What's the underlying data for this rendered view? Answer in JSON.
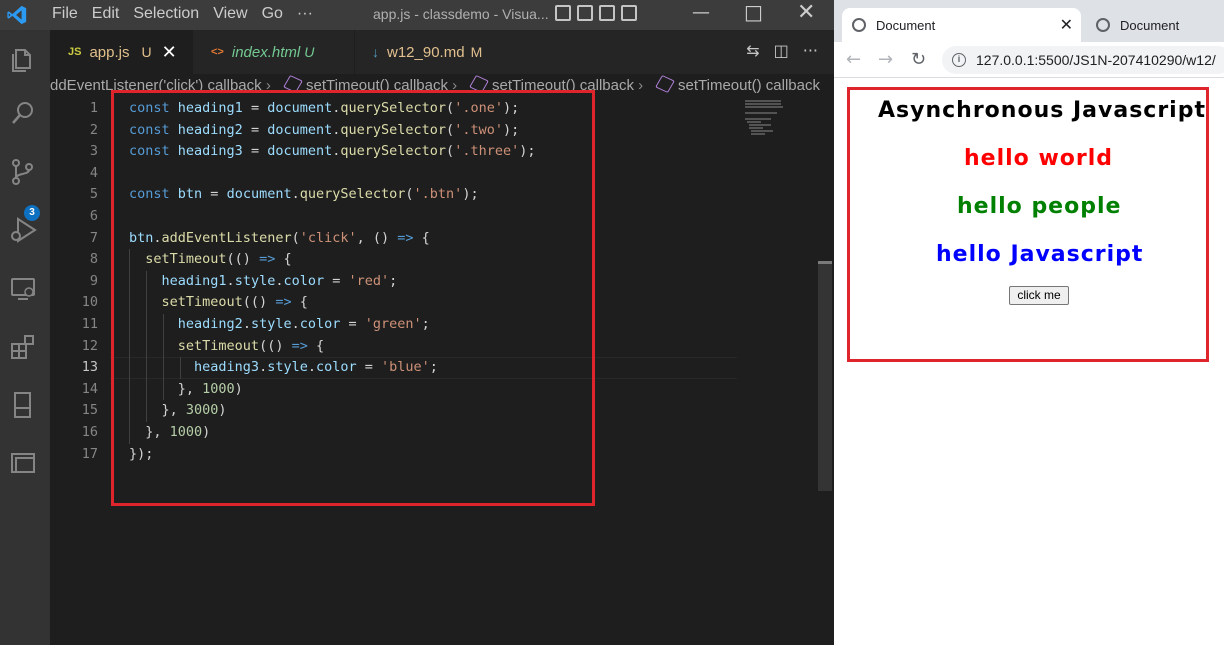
{
  "vscode": {
    "menu": [
      "File",
      "Edit",
      "Selection",
      "View",
      "Go",
      "···"
    ],
    "window_title": "app.js - classdemo - Visua...",
    "scm_badge": "3",
    "tabs": [
      {
        "icon": "JS",
        "label": "app.js",
        "status": "U",
        "active": true,
        "color": "#e2c08d"
      },
      {
        "icon": "<>",
        "label": "index.html",
        "status": "U",
        "active": false,
        "color": "#73c991"
      },
      {
        "icon": "↓",
        "label": "w12_90.md",
        "status": "M",
        "active": false,
        "color": "#e2c08d"
      }
    ],
    "breadcrumbs": [
      "ddEventListener('click') callback",
      "setTimeout() callback",
      "setTimeout() callback",
      "setTimeout() callback"
    ],
    "line_numbers": [
      "1",
      "2",
      "3",
      "4",
      "5",
      "6",
      "7",
      "8",
      "9",
      "10",
      "11",
      "12",
      "13",
      "14",
      "15",
      "16",
      "17"
    ],
    "current_line": "13",
    "code": [
      [
        [
          "kw",
          "const "
        ],
        [
          "vr",
          "heading1"
        ],
        [
          "pl",
          " = "
        ],
        [
          "vr",
          "document"
        ],
        [
          "pl",
          "."
        ],
        [
          "fn",
          "querySelector"
        ],
        [
          "pl",
          "("
        ],
        [
          "st",
          "'.one'"
        ],
        [
          "pl",
          ");"
        ]
      ],
      [
        [
          "kw",
          "const "
        ],
        [
          "vr",
          "heading2"
        ],
        [
          "pl",
          " = "
        ],
        [
          "vr",
          "document"
        ],
        [
          "pl",
          "."
        ],
        [
          "fn",
          "querySelector"
        ],
        [
          "pl",
          "("
        ],
        [
          "st",
          "'.two'"
        ],
        [
          "pl",
          ");"
        ]
      ],
      [
        [
          "kw",
          "const "
        ],
        [
          "vr",
          "heading3"
        ],
        [
          "pl",
          " = "
        ],
        [
          "vr",
          "document"
        ],
        [
          "pl",
          "."
        ],
        [
          "fn",
          "querySelector"
        ],
        [
          "pl",
          "("
        ],
        [
          "st",
          "'.three'"
        ],
        [
          "pl",
          ");"
        ]
      ],
      [],
      [
        [
          "kw",
          "const "
        ],
        [
          "vr",
          "btn"
        ],
        [
          "pl",
          " = "
        ],
        [
          "vr",
          "document"
        ],
        [
          "pl",
          "."
        ],
        [
          "fn",
          "querySelector"
        ],
        [
          "pl",
          "("
        ],
        [
          "st",
          "'.btn'"
        ],
        [
          "pl",
          ");"
        ]
      ],
      [],
      [
        [
          "vr",
          "btn"
        ],
        [
          "pl",
          "."
        ],
        [
          "fn",
          "addEventListener"
        ],
        [
          "pl",
          "("
        ],
        [
          "st",
          "'click'"
        ],
        [
          "pl",
          ", () "
        ],
        [
          "kw",
          "=>"
        ],
        [
          "pl",
          " {"
        ]
      ],
      [
        [
          "pl",
          "  "
        ],
        [
          "fn",
          "setTimeout"
        ],
        [
          "pl",
          "(() "
        ],
        [
          "kw",
          "=>"
        ],
        [
          "pl",
          " {"
        ]
      ],
      [
        [
          "pl",
          "    "
        ],
        [
          "vr",
          "heading1"
        ],
        [
          "pl",
          "."
        ],
        [
          "vr",
          "style"
        ],
        [
          "pl",
          "."
        ],
        [
          "vr",
          "color"
        ],
        [
          "pl",
          " = "
        ],
        [
          "st",
          "'red'"
        ],
        [
          "pl",
          ";"
        ]
      ],
      [
        [
          "pl",
          "    "
        ],
        [
          "fn",
          "setTimeout"
        ],
        [
          "pl",
          "(() "
        ],
        [
          "kw",
          "=>"
        ],
        [
          "pl",
          " {"
        ]
      ],
      [
        [
          "pl",
          "      "
        ],
        [
          "vr",
          "heading2"
        ],
        [
          "pl",
          "."
        ],
        [
          "vr",
          "style"
        ],
        [
          "pl",
          "."
        ],
        [
          "vr",
          "color"
        ],
        [
          "pl",
          " = "
        ],
        [
          "st",
          "'green'"
        ],
        [
          "pl",
          ";"
        ]
      ],
      [
        [
          "pl",
          "      "
        ],
        [
          "fn",
          "setTimeout"
        ],
        [
          "pl",
          "(() "
        ],
        [
          "kw",
          "=>"
        ],
        [
          "pl",
          " {"
        ]
      ],
      [
        [
          "pl",
          "        "
        ],
        [
          "vr",
          "heading3"
        ],
        [
          "pl",
          "."
        ],
        [
          "vr",
          "style"
        ],
        [
          "pl",
          "."
        ],
        [
          "vr",
          "color"
        ],
        [
          "pl",
          " = "
        ],
        [
          "st",
          "'blue'"
        ],
        [
          "pl",
          ";"
        ]
      ],
      [
        [
          "pl",
          "      }, "
        ],
        [
          "nm",
          "1000"
        ],
        [
          "pl",
          ")"
        ]
      ],
      [
        [
          "pl",
          "    }, "
        ],
        [
          "nm",
          "3000"
        ],
        [
          "pl",
          ")"
        ]
      ],
      [
        [
          "pl",
          "  }, "
        ],
        [
          "nm",
          "1000"
        ],
        [
          "pl",
          ")"
        ]
      ],
      [
        [
          "pl",
          "});"
        ]
      ]
    ],
    "highlight_color": "#e0242b"
  },
  "browser": {
    "tabs": [
      {
        "label": "Document",
        "active": true
      },
      {
        "label": "Document",
        "active": false
      }
    ],
    "url": "127.0.0.1:5500/JS1N-207410290/w12/",
    "page": {
      "headings": [
        {
          "text": "Asynchronous Javascript",
          "color": "#000000"
        },
        {
          "text": "hello world",
          "color": "#ff0000"
        },
        {
          "text": "hello people",
          "color": "#008000"
        },
        {
          "text": "hello Javascript",
          "color": "#0000ff"
        }
      ],
      "button_label": "click me"
    }
  }
}
